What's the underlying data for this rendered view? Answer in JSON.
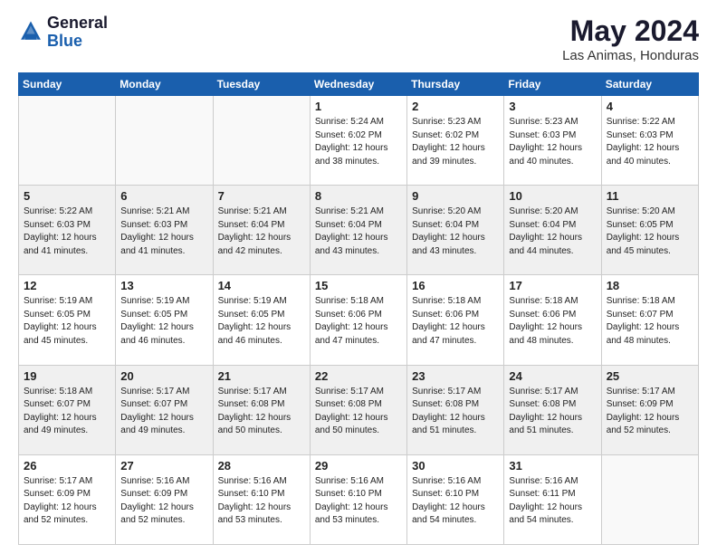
{
  "logo": {
    "line1": "General",
    "line2": "Blue"
  },
  "title": "May 2024",
  "subtitle": "Las Animas, Honduras",
  "weekdays": [
    "Sunday",
    "Monday",
    "Tuesday",
    "Wednesday",
    "Thursday",
    "Friday",
    "Saturday"
  ],
  "weeks": [
    [
      {
        "day": "",
        "info": ""
      },
      {
        "day": "",
        "info": ""
      },
      {
        "day": "",
        "info": ""
      },
      {
        "day": "1",
        "info": "Sunrise: 5:24 AM\nSunset: 6:02 PM\nDaylight: 12 hours\nand 38 minutes."
      },
      {
        "day": "2",
        "info": "Sunrise: 5:23 AM\nSunset: 6:02 PM\nDaylight: 12 hours\nand 39 minutes."
      },
      {
        "day": "3",
        "info": "Sunrise: 5:23 AM\nSunset: 6:03 PM\nDaylight: 12 hours\nand 40 minutes."
      },
      {
        "day": "4",
        "info": "Sunrise: 5:22 AM\nSunset: 6:03 PM\nDaylight: 12 hours\nand 40 minutes."
      }
    ],
    [
      {
        "day": "5",
        "info": "Sunrise: 5:22 AM\nSunset: 6:03 PM\nDaylight: 12 hours\nand 41 minutes."
      },
      {
        "day": "6",
        "info": "Sunrise: 5:21 AM\nSunset: 6:03 PM\nDaylight: 12 hours\nand 41 minutes."
      },
      {
        "day": "7",
        "info": "Sunrise: 5:21 AM\nSunset: 6:04 PM\nDaylight: 12 hours\nand 42 minutes."
      },
      {
        "day": "8",
        "info": "Sunrise: 5:21 AM\nSunset: 6:04 PM\nDaylight: 12 hours\nand 43 minutes."
      },
      {
        "day": "9",
        "info": "Sunrise: 5:20 AM\nSunset: 6:04 PM\nDaylight: 12 hours\nand 43 minutes."
      },
      {
        "day": "10",
        "info": "Sunrise: 5:20 AM\nSunset: 6:04 PM\nDaylight: 12 hours\nand 44 minutes."
      },
      {
        "day": "11",
        "info": "Sunrise: 5:20 AM\nSunset: 6:05 PM\nDaylight: 12 hours\nand 45 minutes."
      }
    ],
    [
      {
        "day": "12",
        "info": "Sunrise: 5:19 AM\nSunset: 6:05 PM\nDaylight: 12 hours\nand 45 minutes."
      },
      {
        "day": "13",
        "info": "Sunrise: 5:19 AM\nSunset: 6:05 PM\nDaylight: 12 hours\nand 46 minutes."
      },
      {
        "day": "14",
        "info": "Sunrise: 5:19 AM\nSunset: 6:05 PM\nDaylight: 12 hours\nand 46 minutes."
      },
      {
        "day": "15",
        "info": "Sunrise: 5:18 AM\nSunset: 6:06 PM\nDaylight: 12 hours\nand 47 minutes."
      },
      {
        "day": "16",
        "info": "Sunrise: 5:18 AM\nSunset: 6:06 PM\nDaylight: 12 hours\nand 47 minutes."
      },
      {
        "day": "17",
        "info": "Sunrise: 5:18 AM\nSunset: 6:06 PM\nDaylight: 12 hours\nand 48 minutes."
      },
      {
        "day": "18",
        "info": "Sunrise: 5:18 AM\nSunset: 6:07 PM\nDaylight: 12 hours\nand 48 minutes."
      }
    ],
    [
      {
        "day": "19",
        "info": "Sunrise: 5:18 AM\nSunset: 6:07 PM\nDaylight: 12 hours\nand 49 minutes."
      },
      {
        "day": "20",
        "info": "Sunrise: 5:17 AM\nSunset: 6:07 PM\nDaylight: 12 hours\nand 49 minutes."
      },
      {
        "day": "21",
        "info": "Sunrise: 5:17 AM\nSunset: 6:08 PM\nDaylight: 12 hours\nand 50 minutes."
      },
      {
        "day": "22",
        "info": "Sunrise: 5:17 AM\nSunset: 6:08 PM\nDaylight: 12 hours\nand 50 minutes."
      },
      {
        "day": "23",
        "info": "Sunrise: 5:17 AM\nSunset: 6:08 PM\nDaylight: 12 hours\nand 51 minutes."
      },
      {
        "day": "24",
        "info": "Sunrise: 5:17 AM\nSunset: 6:08 PM\nDaylight: 12 hours\nand 51 minutes."
      },
      {
        "day": "25",
        "info": "Sunrise: 5:17 AM\nSunset: 6:09 PM\nDaylight: 12 hours\nand 52 minutes."
      }
    ],
    [
      {
        "day": "26",
        "info": "Sunrise: 5:17 AM\nSunset: 6:09 PM\nDaylight: 12 hours\nand 52 minutes."
      },
      {
        "day": "27",
        "info": "Sunrise: 5:16 AM\nSunset: 6:09 PM\nDaylight: 12 hours\nand 52 minutes."
      },
      {
        "day": "28",
        "info": "Sunrise: 5:16 AM\nSunset: 6:10 PM\nDaylight: 12 hours\nand 53 minutes."
      },
      {
        "day": "29",
        "info": "Sunrise: 5:16 AM\nSunset: 6:10 PM\nDaylight: 12 hours\nand 53 minutes."
      },
      {
        "day": "30",
        "info": "Sunrise: 5:16 AM\nSunset: 6:10 PM\nDaylight: 12 hours\nand 54 minutes."
      },
      {
        "day": "31",
        "info": "Sunrise: 5:16 AM\nSunset: 6:11 PM\nDaylight: 12 hours\nand 54 minutes."
      },
      {
        "day": "",
        "info": ""
      }
    ]
  ]
}
